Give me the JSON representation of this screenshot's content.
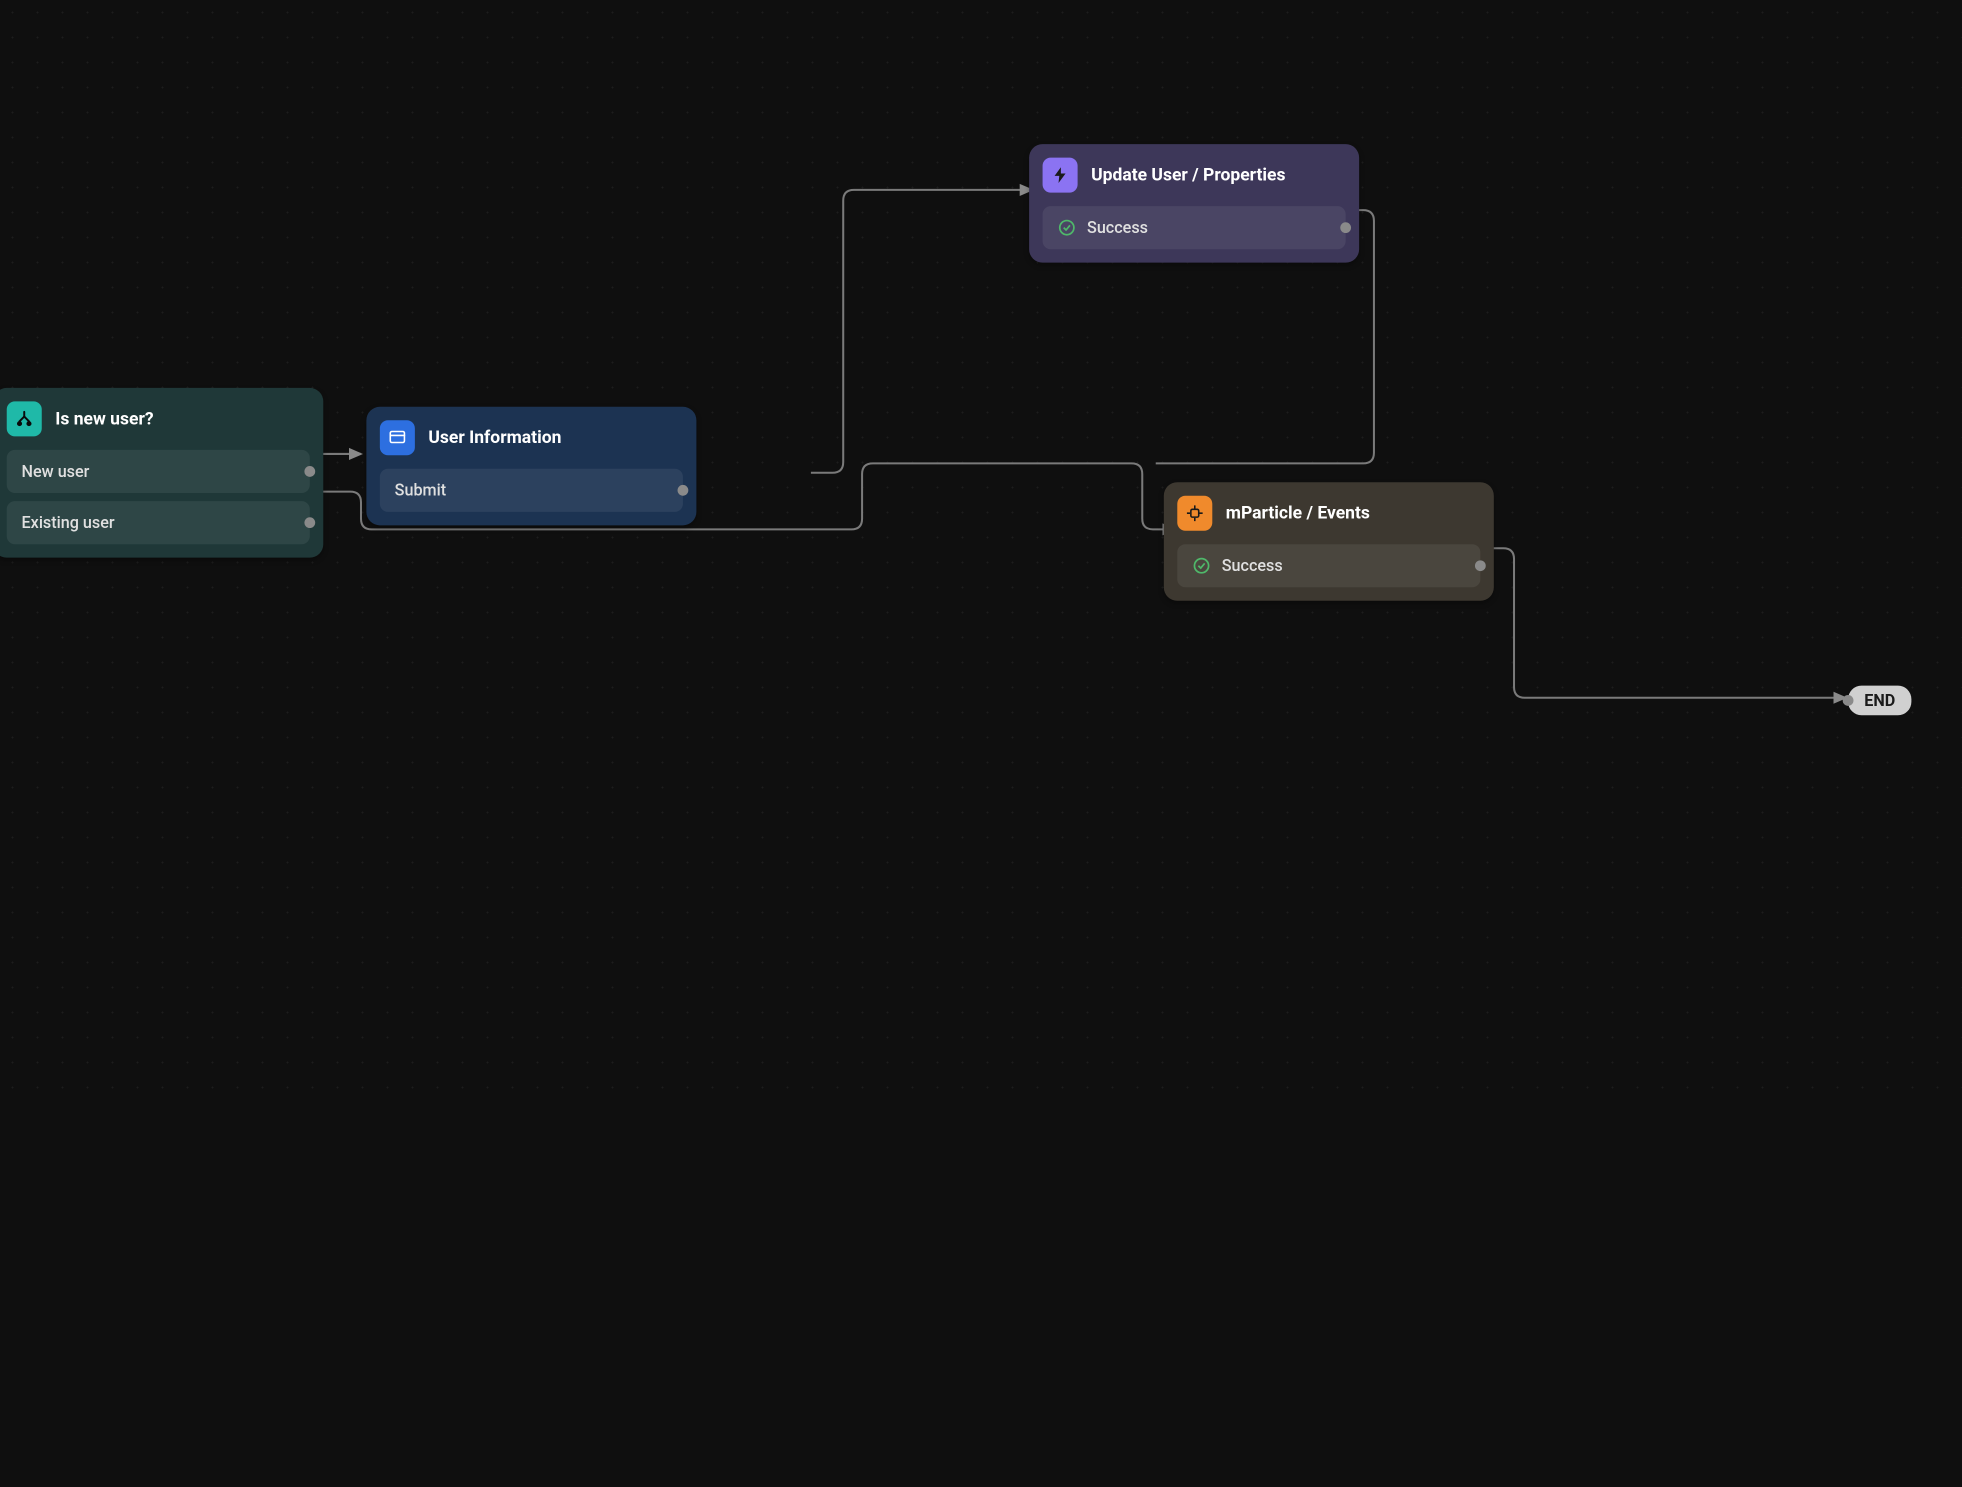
{
  "nodes": {
    "decision": {
      "title": "Is new user?",
      "outputs": [
        "New user",
        "Existing user"
      ]
    },
    "form": {
      "title": "User Information",
      "outputs": [
        "Submit"
      ]
    },
    "update": {
      "title": "Update User / Properties",
      "outputs": [
        "Success"
      ]
    },
    "mparticle": {
      "title": "mParticle / Events",
      "outputs": [
        "Success"
      ]
    }
  },
  "end_label": "END",
  "icons": {
    "branch": "branch-icon",
    "form": "form-icon",
    "bolt": "bolt-icon",
    "plugin": "plugin-icon",
    "success": "success-check-icon"
  }
}
